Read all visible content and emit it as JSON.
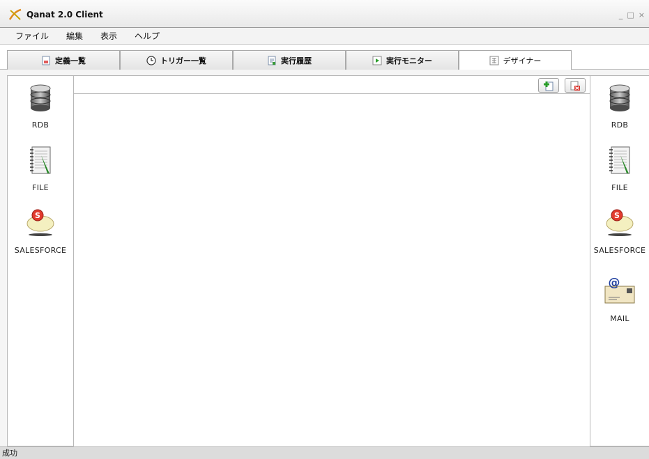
{
  "window": {
    "title": "Qanat 2.0 Client",
    "controls": [
      "_",
      "□",
      "×"
    ]
  },
  "menu": [
    "ファイル",
    "編集",
    "表示",
    "ヘルプ"
  ],
  "tabs": [
    {
      "label": "定義一覧",
      "icon": "document-icon",
      "active": false
    },
    {
      "label": "トリガー一覧",
      "icon": "clock-icon",
      "active": false
    },
    {
      "label": "実行履歴",
      "icon": "history-icon",
      "active": false
    },
    {
      "label": "実行モニター",
      "icon": "play-icon",
      "active": false
    },
    {
      "label": "デザイナー",
      "icon": "designer-icon",
      "active": true
    }
  ],
  "left_palette": [
    {
      "label": "RDB",
      "icon": "database-icon"
    },
    {
      "label": "FILE",
      "icon": "file-notebook-icon"
    },
    {
      "label": "SALESFORCE",
      "icon": "salesforce-cloud-icon"
    }
  ],
  "right_palette": [
    {
      "label": "RDB",
      "icon": "database-icon"
    },
    {
      "label": "FILE",
      "icon": "file-notebook-icon"
    },
    {
      "label": "SALESFORCE",
      "icon": "salesforce-cloud-icon"
    },
    {
      "label": "MAIL",
      "icon": "mail-icon"
    }
  ],
  "toolbar": {
    "add_icon": "add-document-icon",
    "delete_icon": "delete-document-icon"
  },
  "status": "成功",
  "colors": {
    "accent_green": "#2a9d2a",
    "delete_red": "#d9322b",
    "salesforce_red": "#e23b2e"
  }
}
